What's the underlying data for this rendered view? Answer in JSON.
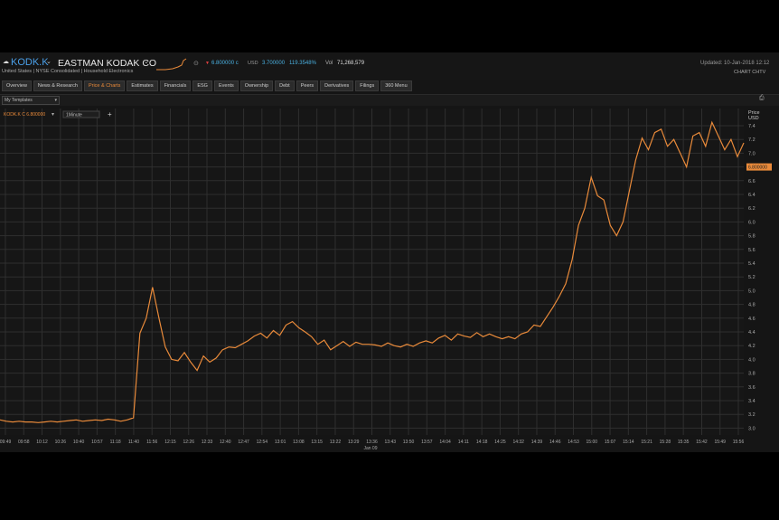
{
  "header": {
    "ticker": "KODK.K",
    "company": "EASTMAN KODAK CO",
    "exchange_line": "United States | NYSE Consolidated | Household Electronics",
    "last_price": "6.800000 c",
    "currency": "USD",
    "change": "3.700000",
    "change_pct": "119.3548%",
    "volume_label": "Vol",
    "volume": "71,268,579",
    "updated": "Updated: 10-Jan-2018 12:12",
    "chart_label": "CHART CHTV"
  },
  "tabs": [
    {
      "label": "Overview",
      "active": false
    },
    {
      "label": "News & Research",
      "active": false
    },
    {
      "label": "Price & Charts",
      "active": true
    },
    {
      "label": "Estimates",
      "active": false
    },
    {
      "label": "Financials",
      "active": false
    },
    {
      "label": "ESG",
      "active": false
    },
    {
      "label": "Events",
      "active": false
    },
    {
      "label": "Ownership",
      "active": false
    },
    {
      "label": "Debt",
      "active": false
    },
    {
      "label": "Peers",
      "active": false
    },
    {
      "label": "Derivatives",
      "active": false
    },
    {
      "label": "Filings",
      "active": false
    },
    {
      "label": "360 Menu",
      "active": false
    }
  ],
  "toolbar": {
    "templates": "My Templates",
    "series_label": "KODK.K  C  6.800000",
    "interval": "1Minute",
    "add": "+",
    "print_icon": "printer-icon"
  },
  "colors": {
    "line": "#e98a3a",
    "accent_blue": "#4a9fe8",
    "background": "#151515",
    "grid": "#2e2e2e"
  },
  "chart_data": {
    "type": "line",
    "title": "",
    "xlabel": "",
    "ylabel": "Price USD",
    "date_label": "Jan 09",
    "ylim": [
      2.9,
      7.65
    ],
    "xlim": [
      0,
      117
    ],
    "yticks": [
      3.0,
      3.2,
      3.4,
      3.6,
      3.8,
      4.0,
      4.2,
      4.4,
      4.6,
      4.8,
      5.0,
      5.2,
      5.4,
      5.6,
      5.8,
      6.0,
      6.2,
      6.4,
      6.6,
      6.8,
      7.0,
      7.2,
      7.4
    ],
    "xtick_labels": [
      "09:49",
      "09:58",
      "10:12",
      "10:26",
      "10:40",
      "10:57",
      "11:18",
      "11:40",
      "11:56",
      "12:15",
      "12:26",
      "12:33",
      "12:40",
      "12:47",
      "12:54",
      "13:01",
      "13:08",
      "13:15",
      "13:22",
      "13:29",
      "13:36",
      "13:43",
      "13:50",
      "13:57",
      "14:04",
      "14:11",
      "14:18",
      "14:25",
      "14:32",
      "14:39",
      "14:46",
      "14:53",
      "15:00",
      "15:07",
      "15:14",
      "15:21",
      "15:28",
      "15:35",
      "15:42",
      "15:49",
      "15:56"
    ],
    "last_value_label": "6.800000",
    "grid": true,
    "series": [
      {
        "values": [
          3.12,
          3.1,
          3.09,
          3.1,
          3.09,
          3.09,
          3.08,
          3.09,
          3.1,
          3.09,
          3.1,
          3.11,
          3.12,
          3.1,
          3.11,
          3.12,
          3.11,
          3.13,
          3.12,
          3.1,
          3.12,
          3.15,
          4.38,
          4.6,
          5.05,
          4.6,
          4.18,
          4.0,
          3.98,
          4.1,
          3.96,
          3.84,
          4.05,
          3.96,
          4.02,
          4.14,
          4.18,
          4.17,
          4.22,
          4.27,
          4.34,
          4.38,
          4.31,
          4.42,
          4.35,
          4.5,
          4.55,
          4.46,
          4.4,
          4.33,
          4.22,
          4.28,
          4.14,
          4.2,
          4.26,
          4.19,
          4.25,
          4.22,
          4.22,
          4.21,
          4.19,
          4.24,
          4.2,
          4.18,
          4.22,
          4.19,
          4.24,
          4.27,
          4.24,
          4.31,
          4.35,
          4.28,
          4.37,
          4.34,
          4.32,
          4.39,
          4.33,
          4.37,
          4.33,
          4.3,
          4.33,
          4.3,
          4.37,
          4.4,
          4.5,
          4.48,
          4.62,
          4.76,
          4.92,
          5.1,
          5.45,
          5.95,
          6.2,
          6.65,
          6.38,
          6.32,
          5.95,
          5.8,
          6.0,
          6.45,
          6.9,
          7.22,
          7.05,
          7.3,
          7.35,
          7.1,
          7.2,
          7.0,
          6.8,
          7.25,
          7.3,
          7.1,
          7.45,
          7.25,
          7.05,
          7.2,
          6.95,
          7.15
        ]
      }
    ]
  }
}
